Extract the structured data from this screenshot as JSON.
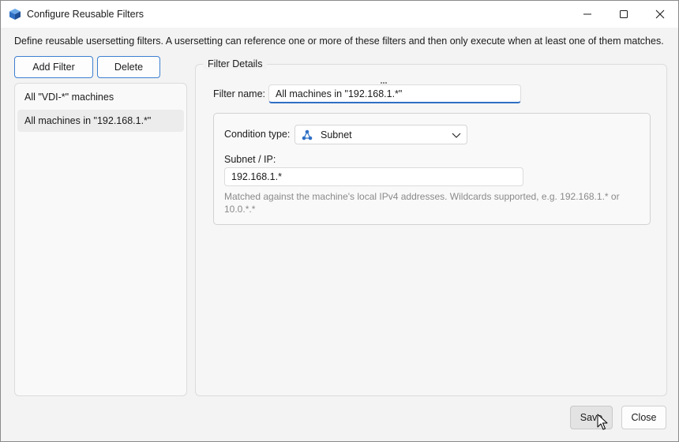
{
  "window": {
    "title": "Configure Reusable Filters",
    "app_icon": "cube-icon"
  },
  "description": "Define reusable usersetting filters. A usersetting can reference one or more of these filters and then only execute when at least one of them matches.",
  "toolbar": {
    "add_label": "Add Filter",
    "delete_label": "Delete"
  },
  "filters": {
    "items": [
      {
        "label": "All \"VDI-*\" machines",
        "selected": false
      },
      {
        "label": "All machines in \"192.168.1.*\"",
        "selected": true
      }
    ]
  },
  "details": {
    "group_title": "Filter Details",
    "filter_name_label": "Filter name:",
    "filter_name_value": "All machines in \"192.168.1.*\"",
    "condition_type_label": "Condition type:",
    "condition_type_value": "Subnet",
    "condition_type_icon": "network-nodes-icon",
    "subnet_label": "Subnet / IP:",
    "subnet_value": "192.168.1.*",
    "hint": "Matched against the machine's local IPv4 addresses. Wildcards supported, e.g. 192.168.1.* or 10.0.*.*"
  },
  "footer": {
    "save_label": "Save",
    "close_label": "Close"
  },
  "colors": {
    "accent": "#2f6fc4",
    "window_bg": "#f3f3f3"
  }
}
